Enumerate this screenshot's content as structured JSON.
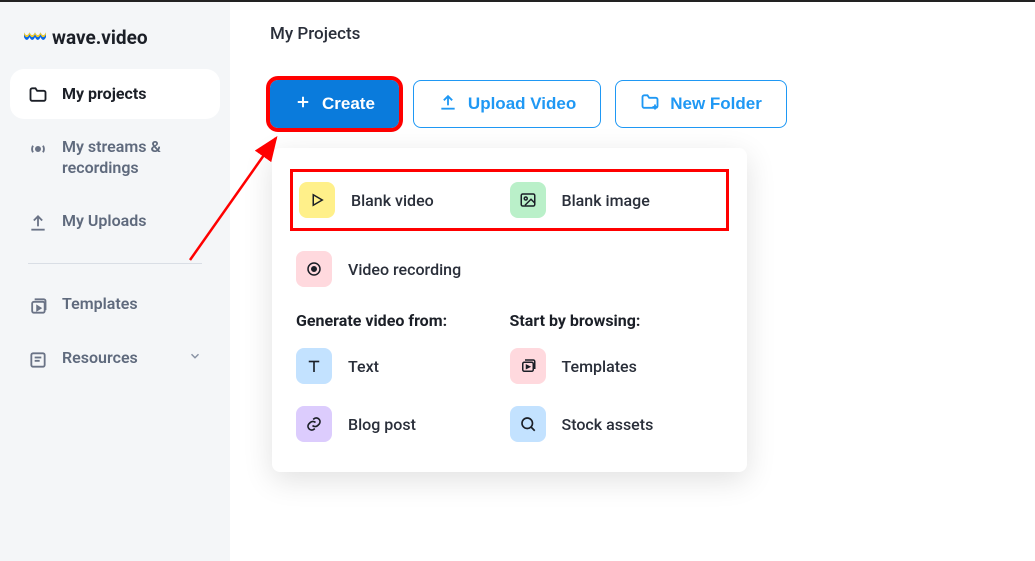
{
  "logo_text": "wave.video",
  "sidebar": {
    "items": [
      {
        "label": "My projects"
      },
      {
        "label": "My streams & recordings"
      },
      {
        "label": "My Uploads"
      },
      {
        "label": "Templates"
      },
      {
        "label": "Resources"
      }
    ]
  },
  "main": {
    "page_title": "My Projects",
    "buttons": {
      "create": "Create",
      "upload": "Upload Video",
      "new_folder": "New Folder"
    }
  },
  "dropdown": {
    "top_row": {
      "blank_video": "Blank video",
      "blank_image": "Blank image"
    },
    "video_recording": "Video recording",
    "generate_title": "Generate video from:",
    "browse_title": "Start by browsing:",
    "generate": {
      "text": "Text",
      "blog": "Blog post"
    },
    "browse": {
      "templates": "Templates",
      "stock": "Stock assets"
    }
  },
  "colors": {
    "icon_yellow": "#fff08a",
    "icon_green": "#baf0c9",
    "icon_pink": "#ffd9de",
    "icon_blue": "#c3e2ff",
    "icon_purple": "#dcccfd"
  }
}
